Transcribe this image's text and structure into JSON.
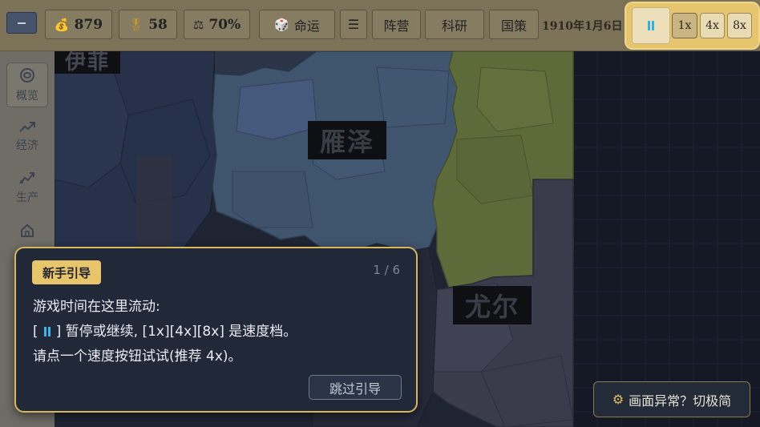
{
  "topbar": {
    "gold": "879",
    "medals": "58",
    "stability": "70%",
    "destiny_label": "命运",
    "faction_label": "阵营",
    "research_label": "科研",
    "policy_label": "国策",
    "date": "1910年1月6日"
  },
  "speed": {
    "one_x": "1x",
    "four_x": "4x",
    "eight_x": "8x",
    "active": "1x",
    "paused": true
  },
  "sidebar": {
    "items": [
      {
        "label": "概览",
        "icon": "eye-icon"
      },
      {
        "label": "经济",
        "icon": "trend-up-icon"
      },
      {
        "label": "生产",
        "icon": "production-icon"
      },
      {
        "label": "",
        "icon": "home-icon"
      }
    ]
  },
  "map": {
    "regions": [
      "伊菲",
      "雁泽",
      "尤尔"
    ]
  },
  "tutorial": {
    "badge": "新手引导",
    "step": "1 / 6",
    "line1": "游戏时间在这里流动:",
    "line2_open": "[",
    "line2_rest": "] 暂停或继续, [1x][4x][8x] 是速度档。",
    "line3": "请点一个速度按钮试试(推荐 4x)。",
    "skip": "跳过引导"
  },
  "perf_button": {
    "label": "画面异常？切极简"
  },
  "colors": {
    "accent_gold": "#e8c46a",
    "pause_blue": "#33b0e6",
    "panel_bg": "#212838"
  }
}
